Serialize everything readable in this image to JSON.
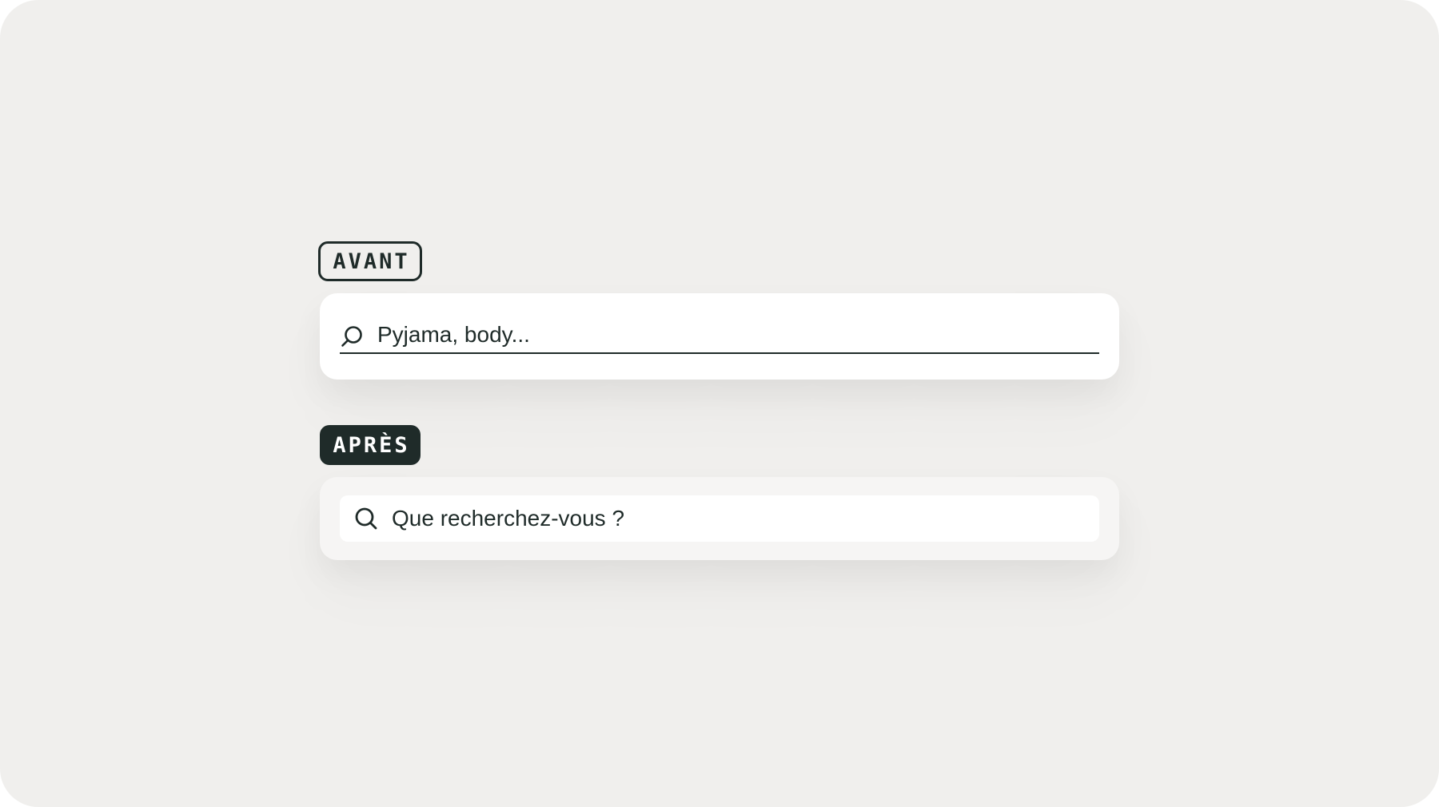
{
  "before": {
    "badge_label": "AVANT",
    "search": {
      "placeholder": "Pyjama, body...",
      "icon": "search-icon"
    }
  },
  "after": {
    "badge_label": "APRÈS",
    "search": {
      "placeholder": "Que recherchez-vous ?",
      "icon": "search-icon"
    }
  },
  "colors": {
    "background": "#f0efed",
    "accent_dark": "#1f2b29",
    "card_before": "#ffffff",
    "card_after": "#f6f5f4"
  }
}
